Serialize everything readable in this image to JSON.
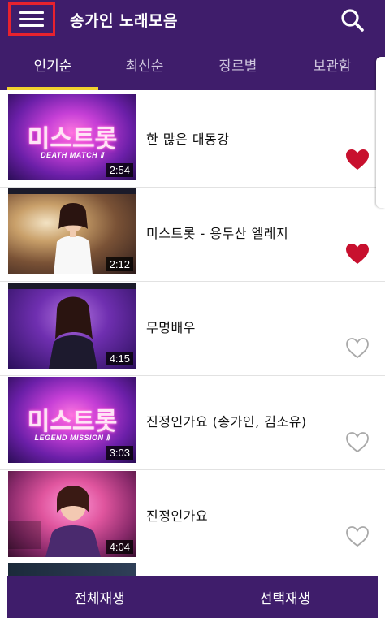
{
  "header": {
    "title": "송가인 노래모음"
  },
  "tabs": [
    {
      "label": "인기순",
      "active": true
    },
    {
      "label": "최신순",
      "active": false
    },
    {
      "label": "장르별",
      "active": false
    },
    {
      "label": "보관함",
      "active": false
    }
  ],
  "songs": [
    {
      "title": "한 많은 대동강",
      "duration": "2:54",
      "favorite": true
    },
    {
      "title": "미스트롯 - 용두산 엘레지",
      "duration": "2:12",
      "favorite": true
    },
    {
      "title": "무명배우",
      "duration": "4:15",
      "favorite": false
    },
    {
      "title": "진정인가요 (송가인, 김소유)",
      "duration": "3:03",
      "favorite": false
    },
    {
      "title": "진정인가요",
      "duration": "4:04",
      "favorite": false
    }
  ],
  "thumbnails": {
    "logo_1": "미스트롯",
    "subtitle_1": "DEATH MATCH Ⅱ",
    "logo_4": "미스트롯",
    "subtitle_4": "LEGEND MISSION Ⅱ"
  },
  "bottom": {
    "play_all": "전체재생",
    "play_selected": "선택재생"
  },
  "colors": {
    "primary": "#3f1d6b",
    "indicator": "#f2d22e",
    "heart": "#c8102e",
    "menu_highlight": "#e8222e"
  }
}
